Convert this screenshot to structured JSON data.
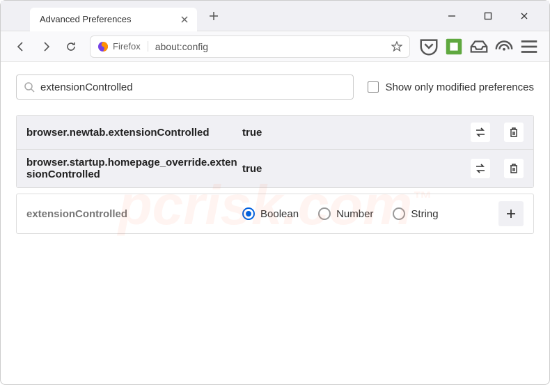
{
  "window": {
    "tab_title": "Advanced Preferences"
  },
  "urlbar": {
    "context": "Firefox",
    "url": "about:config"
  },
  "search": {
    "value": "extensionControlled",
    "checkbox_label": "Show only modified preferences"
  },
  "prefs": [
    {
      "name": "browser.newtab.extensionControlled",
      "value": "true"
    },
    {
      "name": "browser.startup.homepage_override.extensionControlled",
      "value": "true"
    }
  ],
  "new_pref": {
    "name": "extensionControlled",
    "types": [
      "Boolean",
      "Number",
      "String"
    ],
    "selected": "Boolean"
  },
  "watermark": "pcrisk.com"
}
